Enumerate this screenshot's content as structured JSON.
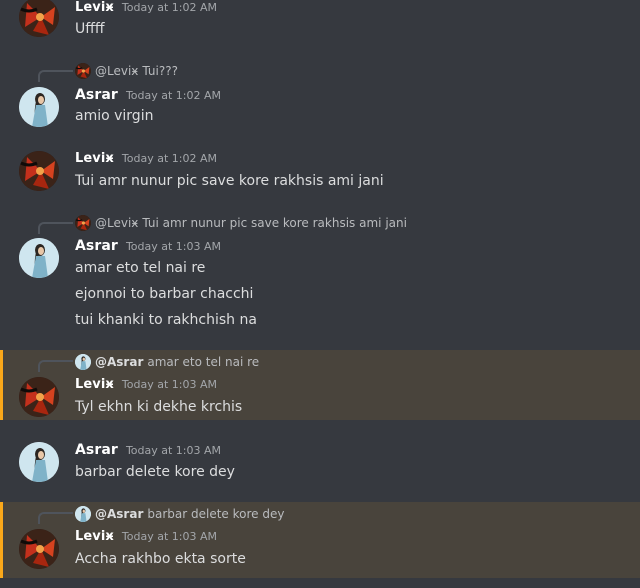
{
  "messages": [
    {
      "id": "m1",
      "author": "Leviӿ",
      "timestamp": "Today at 1:02 AM",
      "lines": [
        "Uffff"
      ]
    },
    {
      "id": "m2",
      "reply": {
        "name": "@Leviӿ",
        "text": "Tui???"
      },
      "author": "Asrar",
      "timestamp": "Today at 1:02 AM",
      "lines": [
        "amio virgin"
      ]
    },
    {
      "id": "m3",
      "author": "Leviӿ",
      "timestamp": "Today at 1:02 AM",
      "lines": [
        "Tui amr nunur pic save kore rakhsis ami jani"
      ]
    },
    {
      "id": "m4",
      "reply": {
        "name": "@Leviӿ",
        "text": "Tui amr nunur pic save kore rakhsis ami jani"
      },
      "author": "Asrar",
      "timestamp": "Today at 1:03 AM",
      "lines": [
        "amar eto tel nai re",
        "ejonnoi to barbar chacchi",
        "tui khanki to rakhchish na"
      ]
    },
    {
      "id": "m5",
      "reply": {
        "name": "@Asrar",
        "text": "amar eto tel nai re"
      },
      "author": "Leviӿ",
      "timestamp": "Today at 1:03 AM",
      "lines": [
        "Tyl ekhn ki dekhe krchis"
      ]
    },
    {
      "id": "m6",
      "author": "Asrar",
      "timestamp": "Today at 1:03 AM",
      "lines": [
        "barbar delete kore dey"
      ]
    },
    {
      "id": "m7",
      "reply": {
        "name": "@Asrar",
        "text": "barbar delete kore dey"
      },
      "author": "Leviӿ",
      "timestamp": "Today at 1:03 AM",
      "lines": [
        "Accha rakhbo ekta sorte"
      ]
    }
  ],
  "colors": {
    "background": "#36393f",
    "mention_background": "#49443c",
    "mention_bar": "#faa81a"
  }
}
